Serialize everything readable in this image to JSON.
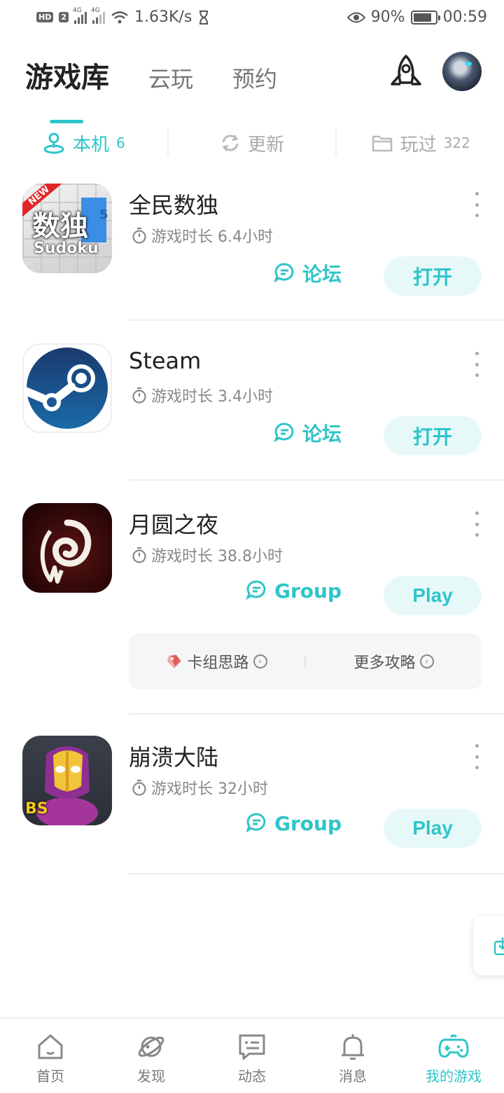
{
  "status_bar": {
    "hd_badge": "HD",
    "hd_num": "2",
    "net1": "4G",
    "net2": "4G",
    "speed": "1.63K/s",
    "battery_pct": "90%",
    "time": "00:59"
  },
  "header": {
    "tabs": [
      {
        "label": "游戏库",
        "active": true
      },
      {
        "label": "云玩",
        "active": false
      },
      {
        "label": "预约",
        "active": false
      }
    ]
  },
  "sub_tabs": [
    {
      "label": "本机",
      "count": "6",
      "active": true
    },
    {
      "label": "更新",
      "count": "",
      "active": false
    },
    {
      "label": "玩过",
      "count": "322",
      "active": false
    }
  ],
  "games": [
    {
      "title": "全民数独",
      "playtime": "游戏时长 6.4小时",
      "forum_label": "论坛",
      "open_label": "打开",
      "icon_text": "数独",
      "icon_sub": "Sudoku",
      "icon_badge": "NEW",
      "icon_num": "5"
    },
    {
      "title": "Steam",
      "playtime": "游戏时长 3.4小时",
      "forum_label": "论坛",
      "open_label": "打开"
    },
    {
      "title": "月圆之夜",
      "playtime": "游戏时长 38.8小时",
      "forum_label": "Group",
      "open_label": "Play",
      "guides": [
        {
          "label": "卡组思路"
        },
        {
          "label": "更多攻略"
        }
      ]
    },
    {
      "title": "崩溃大陆",
      "playtime": "游戏时长 32小时",
      "forum_label": "Group",
      "open_label": "Play",
      "icon_text": "BS"
    }
  ],
  "bottom_nav": [
    {
      "label": "首页",
      "icon": "home-icon",
      "active": false
    },
    {
      "label": "发现",
      "icon": "planet-icon",
      "active": false
    },
    {
      "label": "动态",
      "icon": "chat-icon",
      "active": false
    },
    {
      "label": "消息",
      "icon": "bell-icon",
      "active": false
    },
    {
      "label": "我的游戏",
      "icon": "gamepad-icon",
      "active": true
    }
  ],
  "colors": {
    "accent": "#2ec5c9",
    "play_bg": "#e7f8f9"
  }
}
